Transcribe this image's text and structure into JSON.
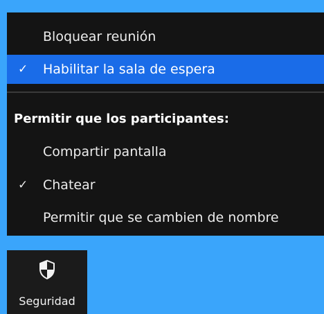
{
  "security_menu": {
    "lock_meeting": {
      "label": "Bloquear reunión",
      "checked": false
    },
    "waiting_room": {
      "label": "Habilitar la sala de espera",
      "checked": true,
      "check_glyph": "✓"
    },
    "participants_heading": "Permitir que los participantes:",
    "share_screen": {
      "label": "Compartir pantalla",
      "checked": false
    },
    "chat": {
      "label": "Chatear",
      "checked": true,
      "check_glyph": "✓"
    },
    "rename": {
      "label": "Permitir que se cambien de nombre",
      "checked": false
    }
  },
  "toolbar": {
    "security_button": {
      "label": "Seguridad",
      "icon": "shield-icon"
    }
  },
  "colors": {
    "background": "#3aa5fb",
    "menu_background": "#141414",
    "selected_background": "#1a6ce8",
    "toolbar_background": "#1b1b1b"
  }
}
